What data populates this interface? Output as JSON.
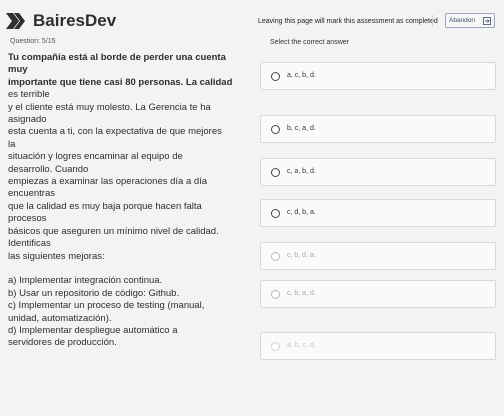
{
  "header": {
    "logo_text": "BairesDev",
    "notice": "Leaving this page will mark this assessment as completed",
    "abandon_label": "Abandon"
  },
  "question_count": "Question: 5/15",
  "select_label": "Select the correct answer",
  "question": {
    "lines": [
      "Tu compañía está al borde de perder una cuenta",
      "muy",
      "importante que tiene casi 80 personas. La calidad",
      "es terrible",
      "y el cliente está muy molesto. La Gerencia te ha",
      "asignado",
      "esta cuenta a ti, con la expectativa de que mejores",
      "la",
      "situación y logres encaminar al equipo de",
      "desarrollo. Cuando",
      "empiezas a examinar las operaciones día a día",
      "encuentras",
      "que la calidad es muy baja porque hacen falta",
      "procesos",
      "básicos que aseguren un mínimo nivel de calidad.",
      "Identificas",
      "las siguientes mejoras:",
      "",
      "a) Implementar integración continua.",
      "b) Usar un repositorio de código: Github.",
      "c) Implementar un proceso de testing (manual,",
      "unidad, automatización).",
      "d) Implementar despliegue automático a",
      "servidores de producción."
    ]
  },
  "options": [
    {
      "label": "a, c, b, d."
    },
    {
      "label": "b, c, a, d."
    },
    {
      "label": "c, a, b, d."
    },
    {
      "label": "c, d, b, a."
    },
    {
      "label": "c, b, d, a."
    },
    {
      "label": "c, b, a, d."
    },
    {
      "label": "a, b, c, d."
    }
  ],
  "colors": {
    "background": "#f3f3f3",
    "option_bg": "#fafafa",
    "option_border": "#d9d9d9",
    "logo": "#2f2f2f"
  }
}
